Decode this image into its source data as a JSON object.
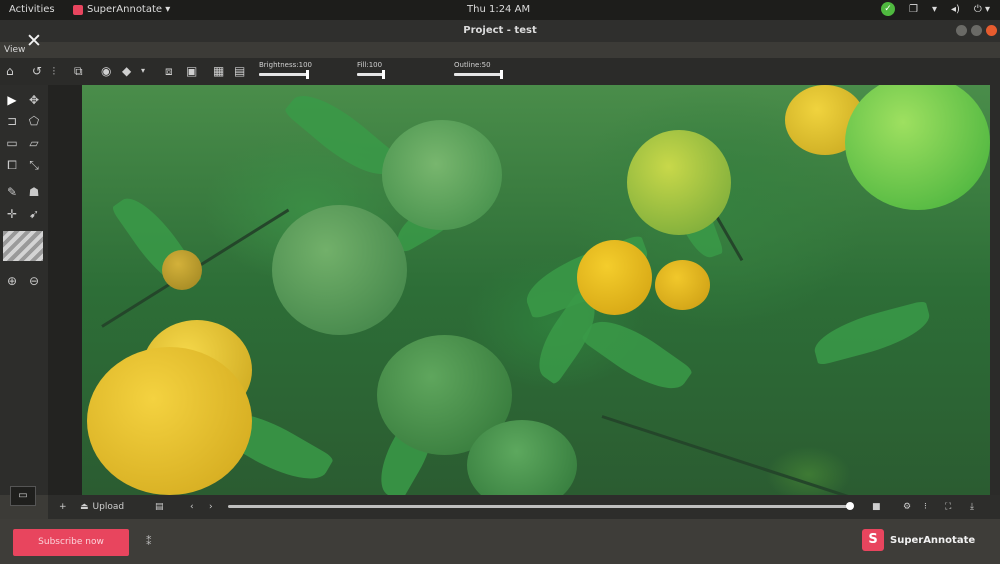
{
  "system_bar": {
    "activities": "Activities",
    "app_name": "SuperAnnotate ▾",
    "clock": "Thu  1:24 AM",
    "tray_icons": [
      "shield-check-icon",
      "window-switch-icon",
      "network-icon",
      "volume-icon",
      "power-icon"
    ]
  },
  "window": {
    "title": "Project - test"
  },
  "menu": {
    "view": "View"
  },
  "toolbar": {
    "icons": [
      "home-icon",
      "undo-icon",
      "redo-icon",
      "copy-icon",
      "eye-icon",
      "fill-icon",
      "duplicate-icon",
      "paste-icon",
      "grid-icon",
      "layers-icon"
    ],
    "sliders": [
      {
        "label": "Brightness:100",
        "value_fraction": 1.0
      },
      {
        "label": "Fill:100",
        "value_fraction": 1.0
      },
      {
        "label": "Outline:50",
        "value_fraction": 1.0
      }
    ]
  },
  "left_tools": [
    "select-icon",
    "point-icon",
    "polyline-icon",
    "polygon-icon",
    "bbox-icon",
    "rotated-box-icon",
    "cuboid-icon",
    "template-icon",
    "brush-icon",
    "magic-wand-icon",
    "move-icon",
    "pin-icon",
    "zoom-in-icon",
    "zoom-out-icon"
  ],
  "bottom_bar": {
    "add_label": "+",
    "upload_label": "Upload",
    "progress_fraction": 0.99
  },
  "footer": {
    "subscribe_label": "Subscribe now",
    "brand_name": "SuperAnnotate"
  },
  "colors": {
    "accent": "#e8455e",
    "toolbar_bg": "#2b2b29",
    "chrome_bg": "#3c3b37"
  }
}
